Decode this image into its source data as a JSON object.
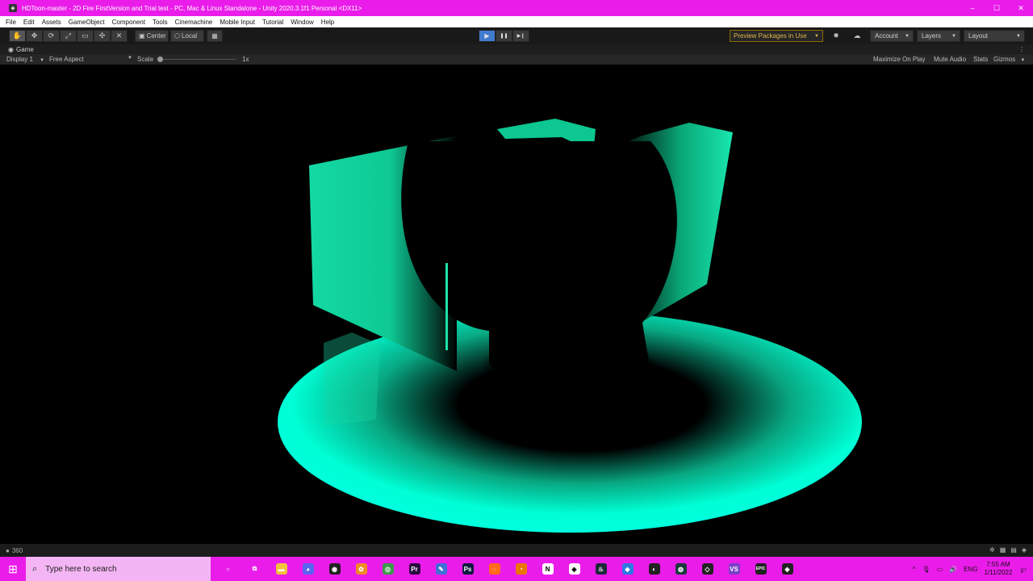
{
  "window": {
    "title": "HDToon-master - 2D Fire FirstVersion and Trial test - PC, Mac & Linux Standalone - Unity 2020.3.1f1 Personal <DX11>",
    "app_icon": "unity-icon",
    "controls": [
      "–",
      "☐",
      "✕"
    ]
  },
  "menu": {
    "items": [
      "File",
      "Edit",
      "Assets",
      "GameObject",
      "Component",
      "Tools",
      "Cinemachine",
      "Mobile Input",
      "Tutorial",
      "Window",
      "Help"
    ]
  },
  "toolbar": {
    "tools": [
      {
        "name": "hand-tool",
        "glyph": "✋"
      },
      {
        "name": "move-tool",
        "glyph": "✥"
      },
      {
        "name": "rotate-tool",
        "glyph": "⟳"
      },
      {
        "name": "scale-tool",
        "glyph": "⤢"
      },
      {
        "name": "rect-tool",
        "glyph": "▭"
      },
      {
        "name": "transform-tool",
        "glyph": "✣"
      },
      {
        "name": "custom-tool",
        "glyph": "✕"
      }
    ],
    "pivot_label": "Center",
    "rotation_label": "Local",
    "grid_glyph": "▦",
    "play_glyph": "▶",
    "pause_glyph": "❚❚",
    "step_glyph": "▶❙",
    "preview_packages": "Preview Packages in Use",
    "account": "Account",
    "layers": "Layers",
    "layout": "Layout",
    "dropdown_arrow": "▼",
    "sun_glyph": "✹",
    "cloud_glyph": "☁"
  },
  "game_view": {
    "tab_label": "Game",
    "more_glyph": "⋮",
    "display": "Display 1",
    "aspect": "Free Aspect",
    "scale_label": "Scale",
    "scale_value": "1x",
    "maximize": "Maximize On Play",
    "mute": "Mute Audio",
    "stats": "Stats",
    "gizmos": "Gizmos"
  },
  "scene": {
    "floor_color": "#00ffd5",
    "wall_color": "#0bd09a"
  },
  "status": {
    "text": "360",
    "info_glyph": "●"
  },
  "taskbar": {
    "search_placeholder": "Type here to search",
    "start_glyph": "⊞",
    "search_glyph": "⌕",
    "apps": [
      {
        "name": "cortana",
        "glyph": "○",
        "color": "transparent"
      },
      {
        "name": "task-view",
        "glyph": "⧉",
        "color": "transparent"
      },
      {
        "name": "file-explorer",
        "glyph": "▬",
        "color": "#f2c23b"
      },
      {
        "name": "discord",
        "glyph": "◕",
        "color": "#5865f2"
      },
      {
        "name": "obs",
        "glyph": "◉",
        "color": "#222222"
      },
      {
        "name": "fl-studio",
        "glyph": "✿",
        "color": "#f08a24"
      },
      {
        "name": "chrome",
        "glyph": "◎",
        "color": "#3a9b4b"
      },
      {
        "name": "premiere",
        "glyph": "Pr",
        "color": "#2a0a40"
      },
      {
        "name": "krita",
        "glyph": "✎",
        "color": "#3d6fd6"
      },
      {
        "name": "photoshop",
        "glyph": "Ps",
        "color": "#0a1a3f"
      },
      {
        "name": "houdini",
        "glyph": "◌",
        "color": "#ff6a1a"
      },
      {
        "name": "blender",
        "glyph": "◔",
        "color": "#ea7600"
      },
      {
        "name": "notion",
        "glyph": "N",
        "color": "#ffffff"
      },
      {
        "name": "unity-hub",
        "glyph": "◈",
        "color": "#ffffff"
      },
      {
        "name": "steam",
        "glyph": "♨",
        "color": "#1b2838"
      },
      {
        "name": "app-blue",
        "glyph": "◆",
        "color": "#2a7be0"
      },
      {
        "name": "github",
        "glyph": "◐",
        "color": "#222222"
      },
      {
        "name": "app-dark",
        "glyph": "◍",
        "color": "#1a3a3a"
      },
      {
        "name": "unity",
        "glyph": "◇",
        "color": "#222222"
      },
      {
        "name": "visual-studio",
        "glyph": "VS",
        "color": "#7a3fc7"
      },
      {
        "name": "epic",
        "glyph": "EPIC",
        "color": "#222222"
      },
      {
        "name": "unity-editor",
        "glyph": "◈",
        "color": "#222222"
      }
    ],
    "tray": {
      "chevron": "^",
      "lang": "ENG",
      "time": "7:55 AM",
      "date": "1/11/2022",
      "notifications": "2"
    }
  }
}
